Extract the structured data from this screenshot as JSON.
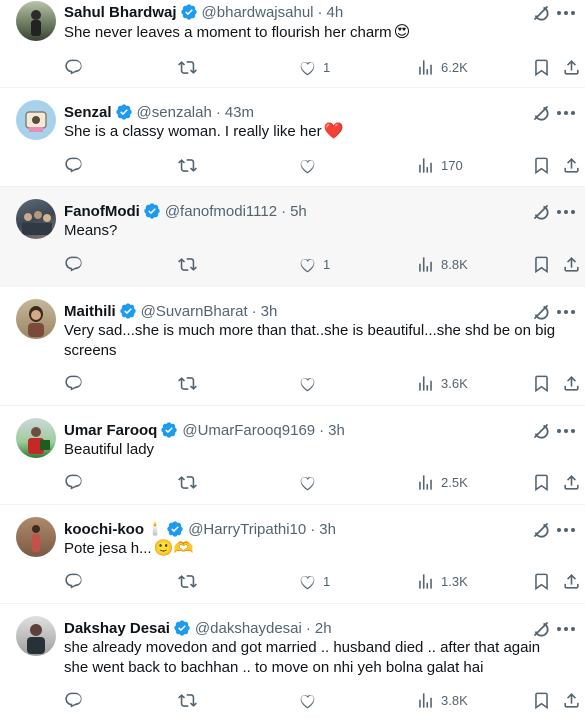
{
  "icons": {
    "verified": "verified-badge-icon",
    "reply": "reply-icon",
    "retweet": "retweet-icon",
    "like": "heart-icon",
    "views": "views-chart-icon",
    "bookmark": "bookmark-icon",
    "share": "share-icon",
    "grok": "grok-icon",
    "more": "more-dots-icon"
  },
  "colors": {
    "verified": "#1d9bf0",
    "muted": "#536471",
    "text": "#0f1419"
  },
  "tweets": [
    {
      "name": "Sahul Bhardwaj",
      "handle": "@bhardwajsahul",
      "time": "4h",
      "text": "She never leaves a moment to flourish her charm",
      "text_emoji": "😍",
      "likes": "1",
      "views": "6.2K"
    },
    {
      "name": "Senzal",
      "handle": "@senzalah",
      "time": "43m",
      "text": "She is a classy woman. I really like her",
      "text_emoji": "❤️",
      "likes": "",
      "views": "170"
    },
    {
      "name": "FanofModi",
      "handle": "@fanofmodi1112",
      "time": "5h",
      "text": "Means?",
      "text_emoji": "",
      "likes": "1",
      "views": "8.8K"
    },
    {
      "name": "Maithili",
      "handle": "@SuvarnBharat",
      "time": "3h",
      "text": "Very sad...she is much more than that..she is beautiful...she shd be on big screens",
      "text_emoji": "",
      "likes": "",
      "views": "3.6K"
    },
    {
      "name": "Umar Farooq",
      "handle": "@UmarFarooq9169",
      "time": "3h",
      "text": "Beautiful lady",
      "text_emoji": "",
      "likes": "",
      "views": "2.5K"
    },
    {
      "name": "koochi-koo",
      "name_emoji": "🕯️",
      "handle": "@HarryTripathi10",
      "time": "3h",
      "text": "Pote jesa h...",
      "text_emoji": "🙂🫶",
      "likes": "1",
      "views": "1.3K"
    },
    {
      "name": "Dakshay Desai",
      "handle": "@dakshaydesai",
      "time": "2h",
      "text": "she already movedon and got married .. husband died .. after that again she went back to bachhan .. to move on nhi yeh bolna galat hai",
      "text_emoji": "",
      "likes": "",
      "views": "3.8K"
    }
  ]
}
